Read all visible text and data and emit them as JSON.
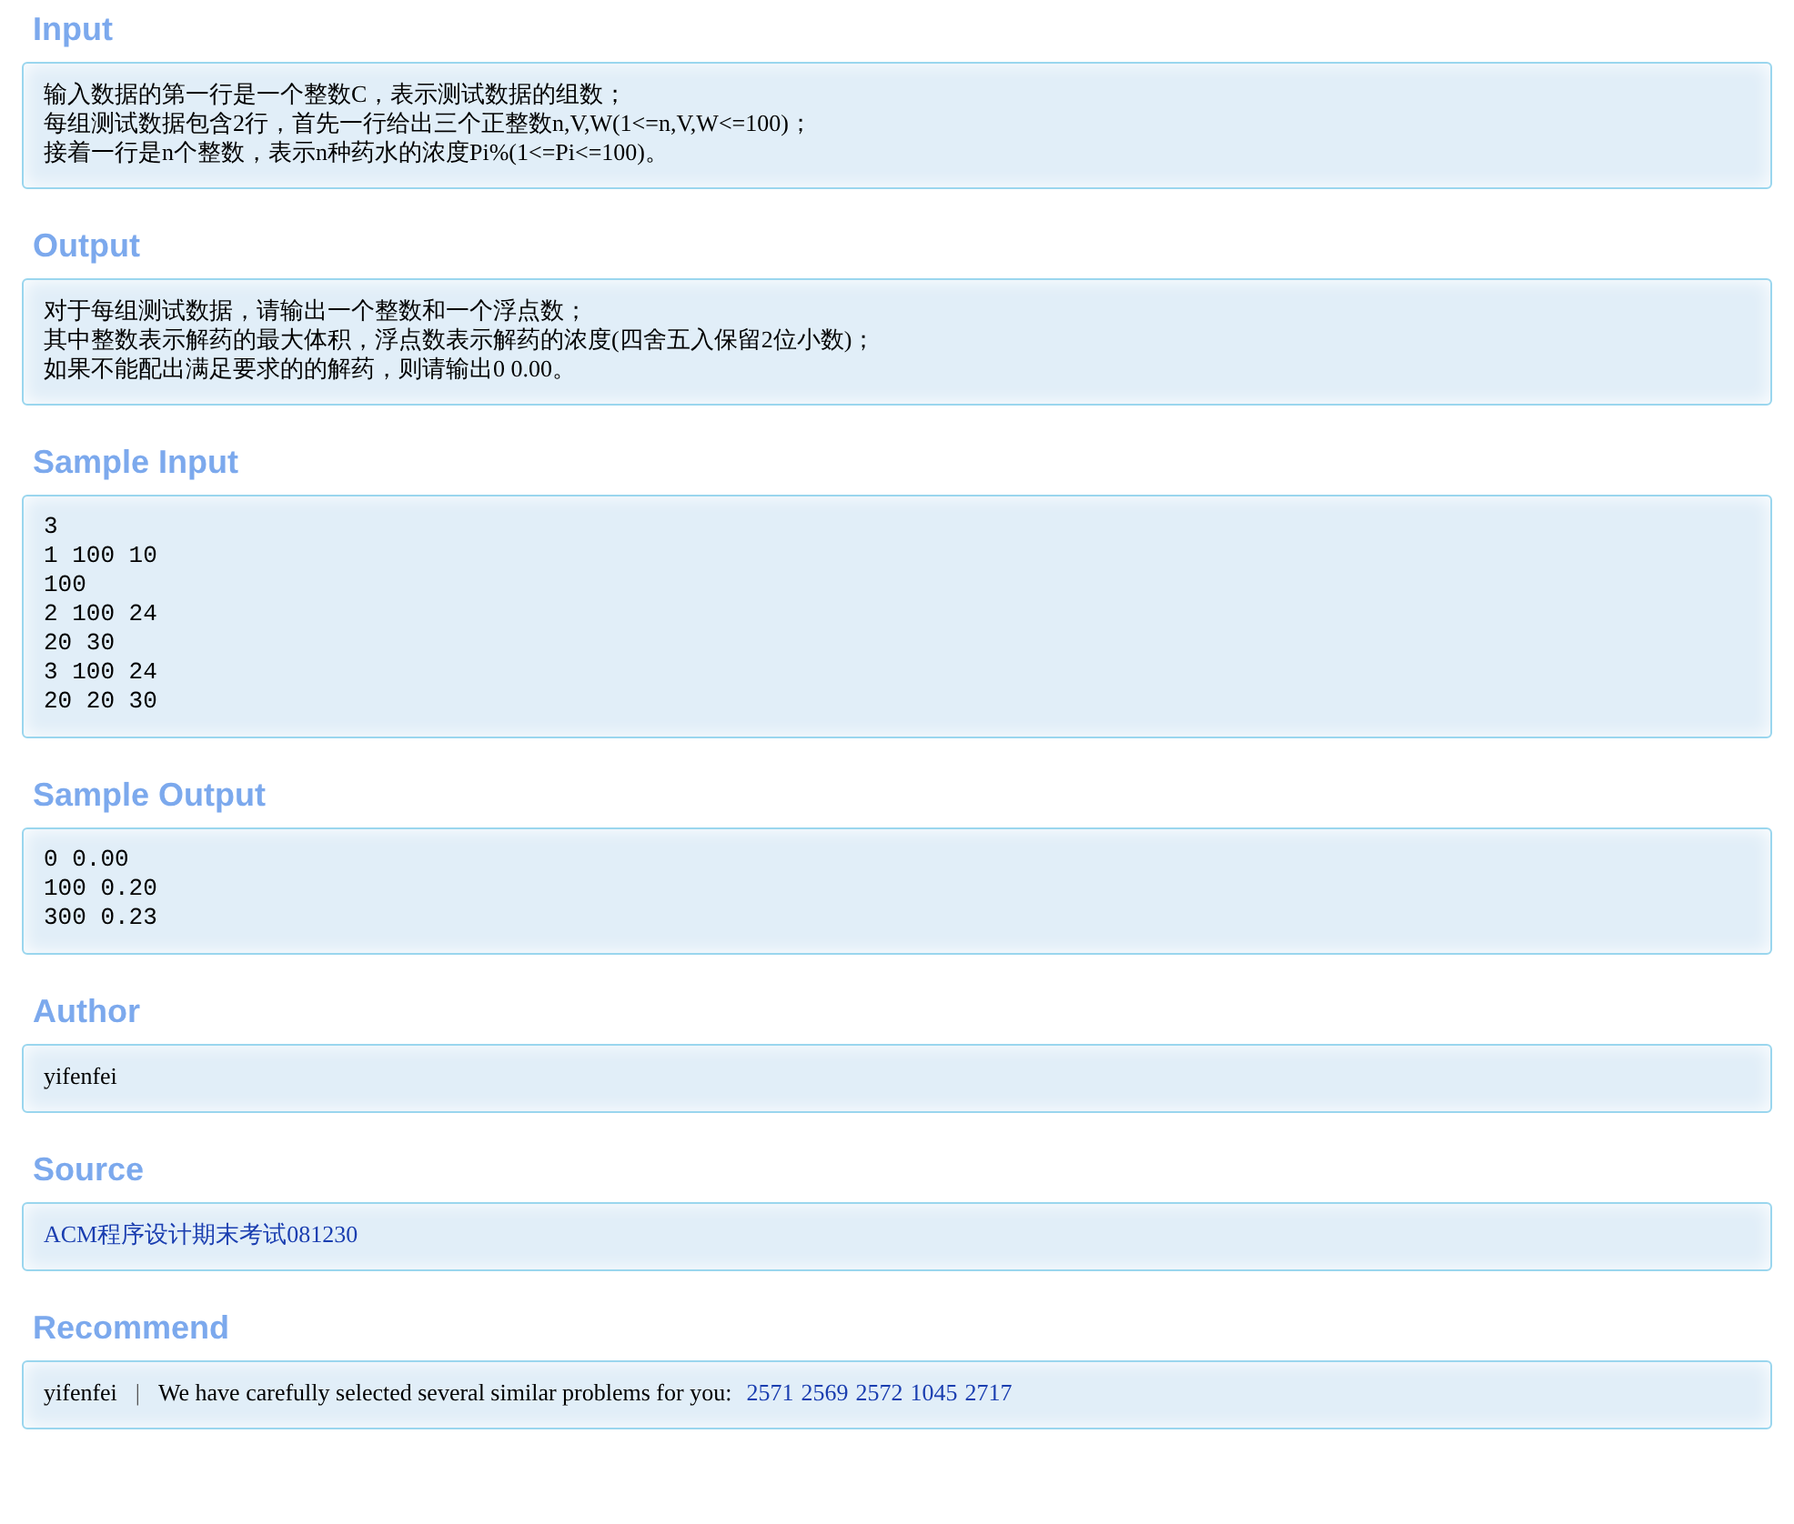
{
  "sections": [
    {
      "kind": "text",
      "title": "Input",
      "lines": [
        "输入数据的第一行是一个整数C，表示测试数据的组数；",
        "每组测试数据包含2行，首先一行给出三个正整数n,V,W(1<=n,V,W<=100)；",
        "接着一行是n个整数，表示n种药水的浓度Pi%(1<=Pi<=100)。"
      ]
    },
    {
      "kind": "text",
      "title": "Output",
      "lines": [
        "对于每组测试数据，请输出一个整数和一个浮点数；",
        "其中整数表示解药的最大体积，浮点数表示解药的浓度(四舍五入保留2位小数)；",
        "如果不能配出满足要求的的解药，则请输出0 0.00。"
      ]
    },
    {
      "kind": "code",
      "title": "Sample Input",
      "lines": [
        "3",
        "1 100 10",
        "100",
        "2 100 24",
        "20 30",
        "3 100 24",
        "20 20 30"
      ]
    },
    {
      "kind": "code",
      "title": "Sample Output",
      "lines": [
        "0 0.00",
        "100 0.20",
        "300 0.23"
      ]
    },
    {
      "kind": "text",
      "title": "Author",
      "lines": [
        "yifenfei"
      ]
    },
    {
      "kind": "link",
      "title": "Source",
      "link": "ACM程序设计期末考试081230"
    },
    {
      "kind": "recommend",
      "title": "Recommend",
      "author": "yifenfei",
      "separator": "|",
      "text": "We have carefully selected several similar problems for you:",
      "problems": [
        "2571",
        "2569",
        "2572",
        "1045",
        "2717"
      ]
    }
  ]
}
